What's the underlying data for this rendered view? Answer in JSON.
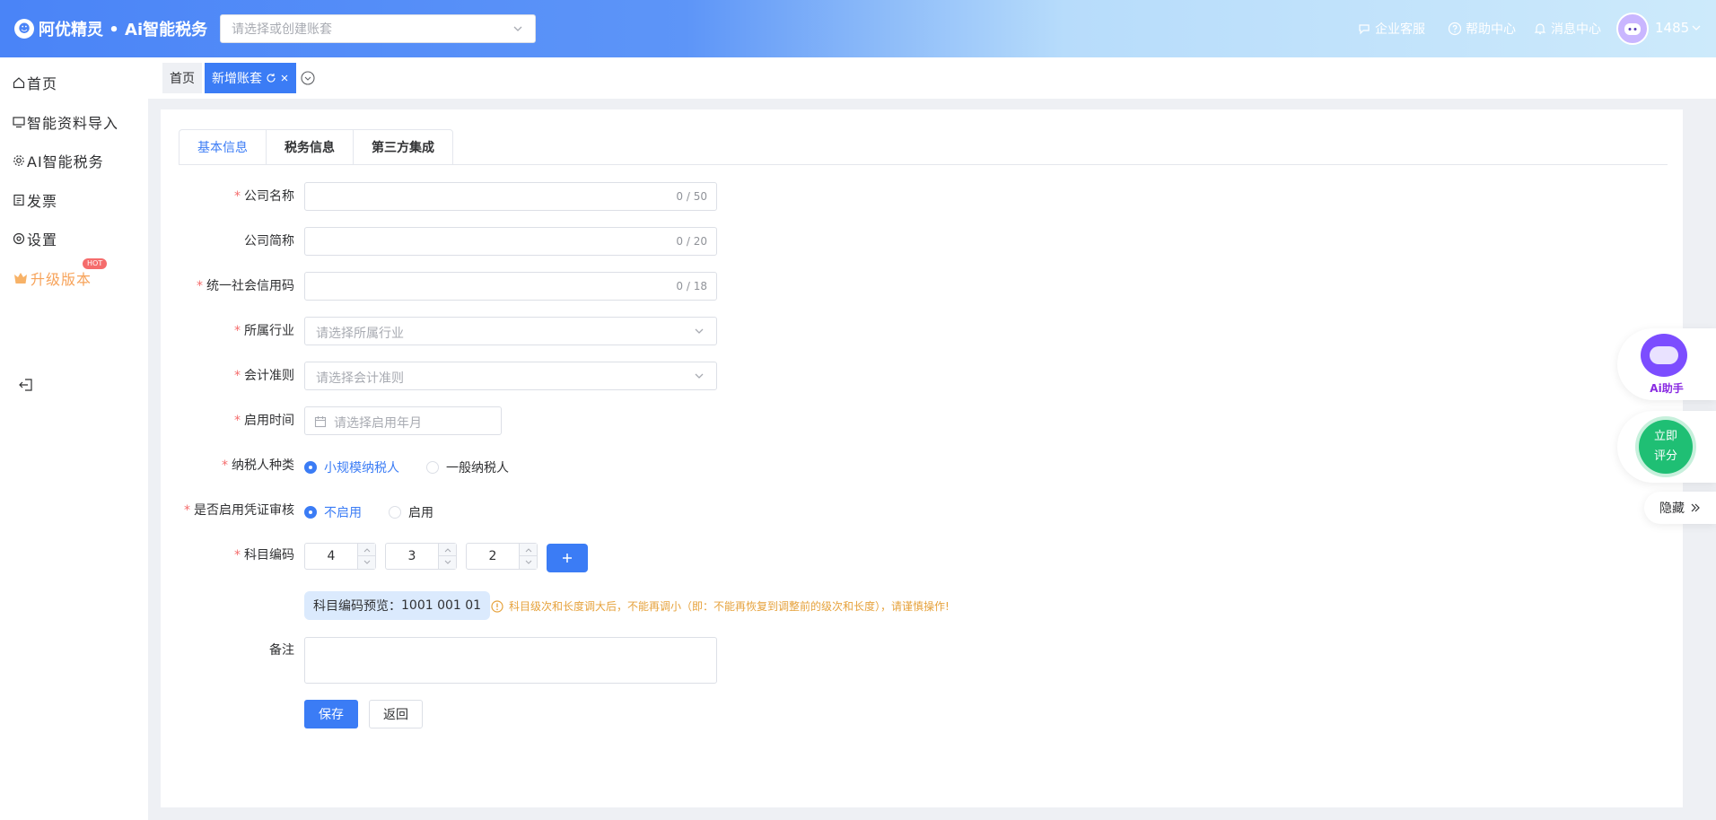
{
  "header": {
    "brand": "阿优精灵 • Ai智能税务",
    "account_placeholder": "请选择或创建账套",
    "nav": [
      "企业客服",
      "帮助中心",
      "消息中心"
    ],
    "user_id": "1485"
  },
  "sidebar": {
    "items": [
      "首页",
      "智能资料导入",
      "AI智能税务",
      "发票",
      "设置",
      "升级版本"
    ],
    "hot_badge": "HOT"
  },
  "page_tabs": [
    "首页",
    "新增账套"
  ],
  "form_tabs": [
    "基本信息",
    "税务信息",
    "第三方集成"
  ],
  "form": {
    "company_name": {
      "label": "公司名称",
      "counter": "0 / 50"
    },
    "short_name": {
      "label": "公司简称",
      "counter": "0 / 20"
    },
    "credit_code": {
      "label": "统一社会信用码",
      "counter": "0 / 18"
    },
    "industry": {
      "label": "所属行业",
      "placeholder": "请选择所属行业"
    },
    "standard": {
      "label": "会计准则",
      "placeholder": "请选择会计准则"
    },
    "start_date": {
      "label": "启用时间",
      "placeholder": "请选择启用年月"
    },
    "taxpayer": {
      "label": "纳税人种类",
      "options": [
        "小规模纳税人",
        "一般纳税人"
      ],
      "selected": "小规模纳税人"
    },
    "voucher_audit": {
      "label": "是否启用凭证审核",
      "options": [
        "不启用",
        "启用"
      ],
      "selected": "不启用"
    },
    "account_code": {
      "label": "科目编码",
      "levels": [
        "4",
        "3",
        "2"
      ]
    },
    "preview_label": "科目编码预览：",
    "preview_value": "1001 001 01",
    "warning": "科目级次和长度调大后，不能再调小（即：不能再恢复到调整前的级次和长度），请谨慎操作!",
    "remark": {
      "label": "备注"
    },
    "save_label": "保存",
    "back_label": "返回"
  },
  "floats": {
    "ai_label": "Ai助手",
    "rate_line1": "立即",
    "rate_line2": "评分",
    "hide_label": "隐藏"
  }
}
